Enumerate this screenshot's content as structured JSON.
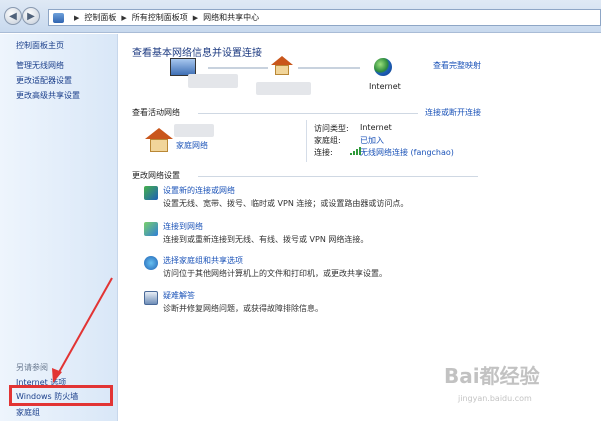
{
  "address_bar": {
    "crumbs": [
      "控制面板",
      "所有控制面板项",
      "网络和共享中心"
    ]
  },
  "sidebar": {
    "home": "控制面板主页",
    "items": [
      "管理无线网络",
      "更改适配器设置",
      "更改高级共享设置"
    ],
    "see_also_title": "另请参阅",
    "see_also": [
      "Internet 选项",
      "Windows 防火墙",
      "家庭组"
    ]
  },
  "main": {
    "title": "查看基本网络信息并设置连接",
    "full_map": "查看完整映射",
    "internet_label": "Internet",
    "active_networks_title": "查看活动网络",
    "connect_disconnect": "连接或断开连接",
    "network_type_link": "家庭网络",
    "access_type_label": "访问类型:",
    "access_type_value": "Internet",
    "homegroup_label": "家庭组:",
    "homegroup_value": "已加入",
    "connection_label": "连接:",
    "connection_value": "无线网络连接 (fangchao)",
    "change_settings_title": "更改网络设置",
    "tasks": [
      {
        "link": "设置新的连接或网络",
        "desc": "设置无线、宽带、拨号、临时或 VPN 连接；或设置路由器或访问点。"
      },
      {
        "link": "连接到网络",
        "desc": "连接到或重新连接到无线、有线、拨号或 VPN 网络连接。"
      },
      {
        "link": "选择家庭组和共享选项",
        "desc": "访问位于其他网络计算机上的文件和打印机，或更改共享设置。"
      },
      {
        "link": "疑难解答",
        "desc": "诊断并修复网络问题，或获得故障排除信息。"
      }
    ]
  },
  "watermark": {
    "text": "Bai都经验",
    "sub": "jingyan.baidu.com"
  },
  "colors": {
    "highlight": "#e23434",
    "link": "#1b53b8"
  }
}
